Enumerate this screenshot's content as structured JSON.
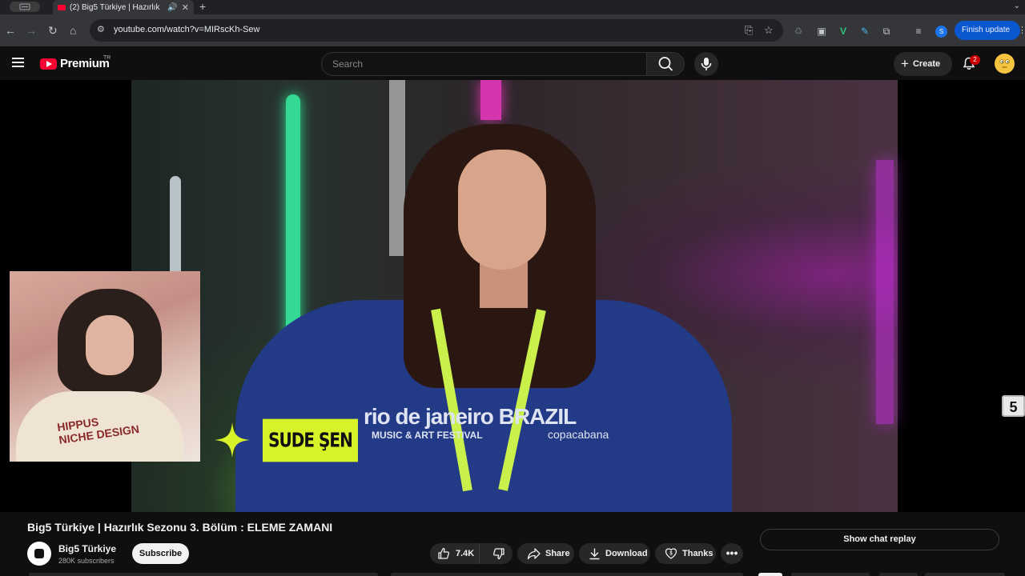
{
  "browser": {
    "tab_search_label": "",
    "tab_title": "(2) Big5 Türkiye | Hazırlık",
    "address": "youtube.com/watch?v=MIRscKh-Sew",
    "finish_update": "Finish update",
    "profile_initial": "S"
  },
  "header": {
    "logo_text": "Premium",
    "region": "TR",
    "search_placeholder": "Search",
    "create_label": "Create",
    "notification_count": "2"
  },
  "video": {
    "name_tag": "SUDE ŞEN",
    "hoodie_text": "rio de janeiro BRAZIL",
    "hoodie_sub": "MUSIC & ART FESTIVAL",
    "hoodie_copa": "copacabana",
    "pip_shirt_text": "HIPPUS\nNICHE DESIGN",
    "channel_bug": "5"
  },
  "info": {
    "title": "Big5 Türkiye | Hazırlık Sezonu 3. Bölüm : ELEME ZAMANI",
    "channel_name": "Big5 Türkiye",
    "subscribers": "280K subscribers",
    "subscribe_label": "Subscribe",
    "likes": "7.4K",
    "share_label": "Share",
    "download_label": "Download",
    "thanks_label": "Thanks",
    "more_label": "•••",
    "chat_replay_label": "Show chat replay"
  },
  "colors": {
    "youtube_red": "#ff0033",
    "name_tag_bg": "#d8f22a",
    "finish_update_bg": "#0b57d0"
  }
}
